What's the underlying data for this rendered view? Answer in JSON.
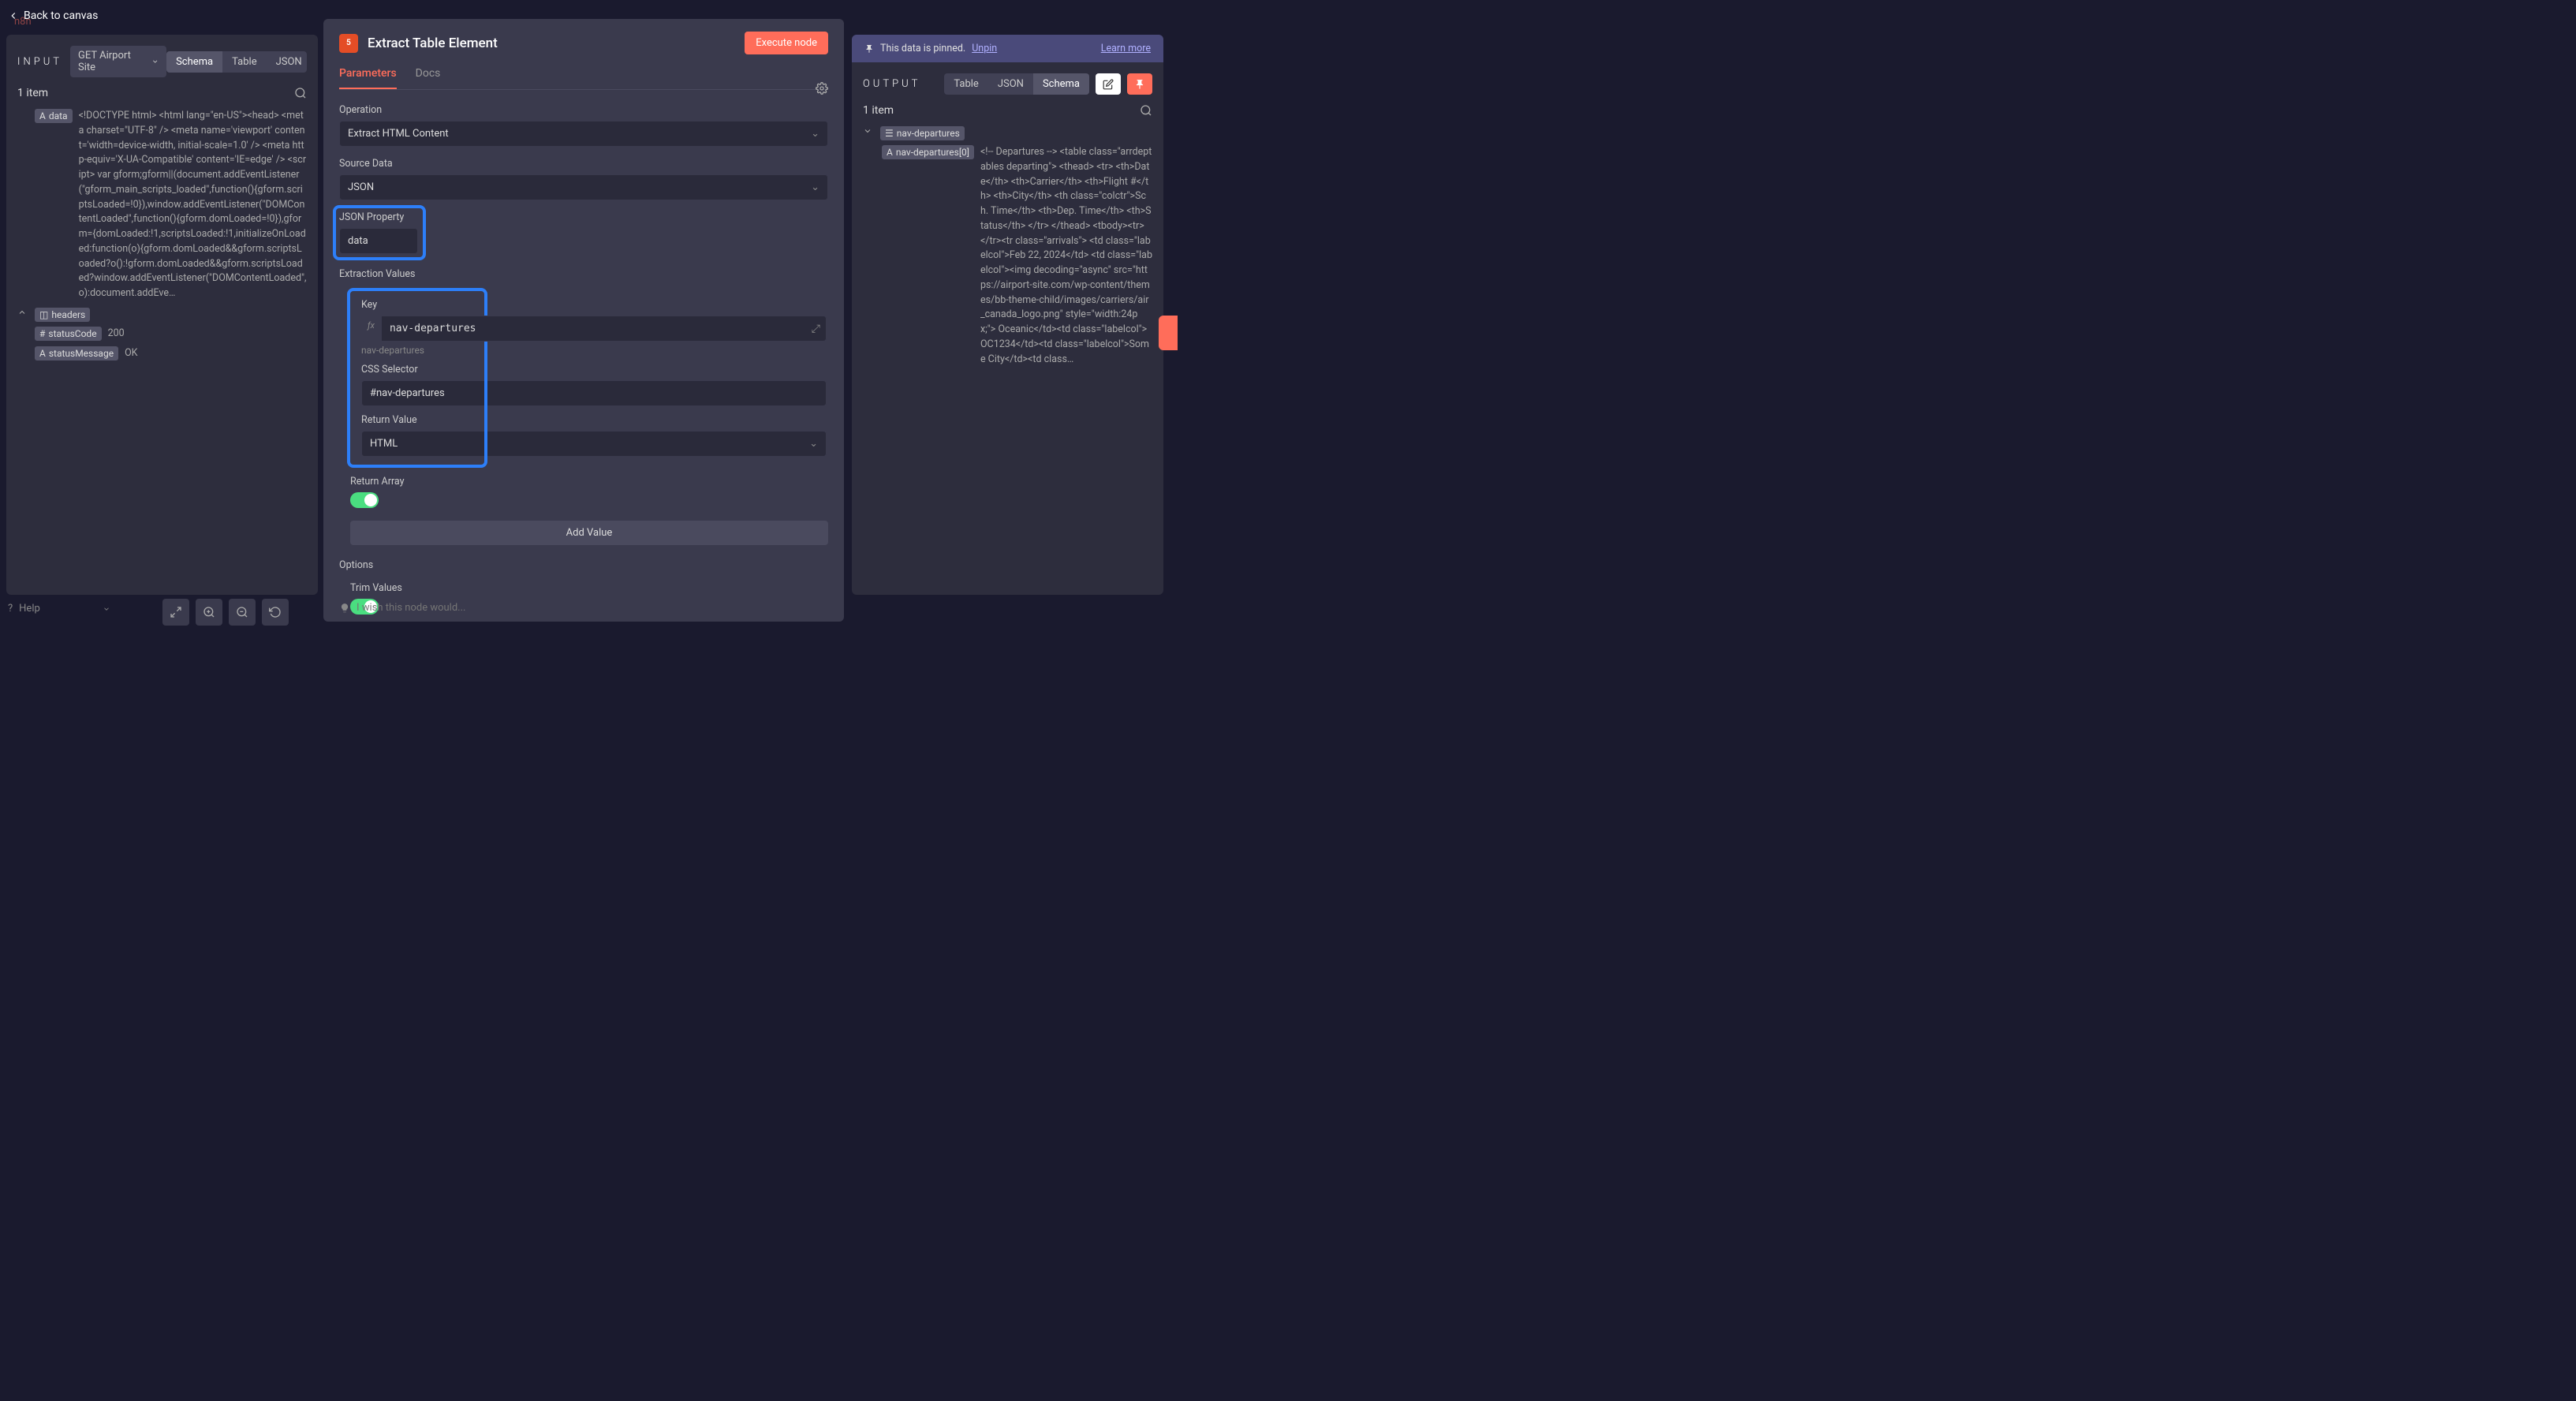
{
  "back_link": "Back to canvas",
  "logo_text": "n8n",
  "input_panel": {
    "title": "INPUT",
    "source_node": "GET Airport Site",
    "views": [
      "Schema",
      "Table",
      "JSON"
    ],
    "active_view": "Schema",
    "item_count": "1 item",
    "schema": {
      "data_key": "data",
      "data_value": "<!DOCTYPE html> <html lang=\"en-US\"><head> <meta charset=\"UTF-8\" /> <meta name='viewport' content='width=device-width, initial-scale=1.0' /> <meta http-equiv='X-UA-Compatible' content='IE=edge' /> <script> var gform;gform||(document.addEventListener(\"gform_main_scripts_loaded\",function(){gform.scriptsLoaded=!0}),window.addEventListener(\"DOMContentLoaded\",function(){gform.domLoaded=!0}),gform={domLoaded:!1,scriptsLoaded:!1,initializeOnLoaded:function(o){gform.domLoaded&&gform.scriptsLoaded?o():!gform.domLoaded&&gform.scriptsLoaded?window.addEventListener(\"DOMContentLoaded\",o):document.addEve…",
      "headers_key": "headers",
      "status_code_key": "statusCode",
      "status_code_value": "200",
      "status_message_key": "statusMessage",
      "status_message_value": "OK"
    }
  },
  "center_panel": {
    "title": "Extract Table Element",
    "execute_btn": "Execute node",
    "tabs": [
      "Parameters",
      "Docs"
    ],
    "active_tab": "Parameters",
    "fields": {
      "operation_label": "Operation",
      "operation_value": "Extract HTML Content",
      "source_data_label": "Source Data",
      "source_data_value": "JSON",
      "json_property_label": "JSON Property",
      "json_property_value": "data",
      "extraction_values_label": "Extraction Values",
      "key_label": "Key",
      "key_value": "nav-departures",
      "key_helper": "nav-departures",
      "css_selector_label": "CSS Selector",
      "css_selector_value": "#nav-departures",
      "return_value_label": "Return Value",
      "return_value_value": "HTML",
      "return_array_label": "Return Array",
      "add_value_btn": "Add Value",
      "options_label": "Options",
      "trim_values_label": "Trim Values"
    },
    "wish_placeholder": "I wish this node would..."
  },
  "output_panel": {
    "pinned_text": "This data is pinned.",
    "unpin": "Unpin",
    "learn_more": "Learn more",
    "title": "OUTPUT",
    "views": [
      "Table",
      "JSON",
      "Schema"
    ],
    "active_view": "Schema",
    "item_count": "1 item",
    "schema": {
      "root_key": "nav-departures",
      "child_key": "nav-departures[0]",
      "child_value": "<!-- Departures --> <table class=\"arrdeptables departing\"> <thead> <tr> <th>Date</th> <th>Carrier</th> <th>Flight #</th> <th>City</th> <th class=\"colctr\">Sch. Time</th> <th>Dep. Time</th> <th>Status</th> </tr> </thead> <tbody><tr> </tr><tr class=\"arrivals\"> <td class=\"labelcol\">Feb 22, 2024</td> <td class=\"labelcol\"><img decoding=\"async\" src=\"https://airport-site.com/wp-content/themes/bb-theme-child/images/carriers/air_canada_logo.png\" style=\"width:24px;\"> Oceanic</td><td class=\"labelcol\">OC1234</td><td class=\"labelcol\">Some City</td><td class…"
    }
  },
  "help_label": "Help"
}
